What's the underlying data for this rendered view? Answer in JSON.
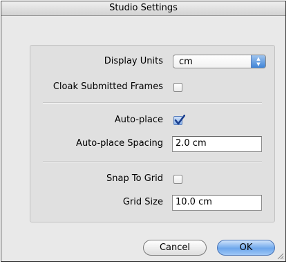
{
  "window": {
    "title": "Studio Settings"
  },
  "settings": {
    "display_units_label": "Display Units",
    "display_units_value": "cm",
    "cloak_label": "Cloak Submitted Frames",
    "cloak_checked": false,
    "autoplace_label": "Auto-place",
    "autoplace_checked": true,
    "autoplace_spacing_label": "Auto-place Spacing",
    "autoplace_spacing_value": "2.0 cm",
    "snap_label": "Snap To Grid",
    "snap_checked": false,
    "grid_size_label": "Grid Size",
    "grid_size_value": "10.0 cm"
  },
  "buttons": {
    "cancel": "Cancel",
    "ok": "OK"
  },
  "icons": {
    "popup": "up-down-arrows-icon",
    "check": "checkmark-icon",
    "resize": "resize-grip-icon"
  },
  "colors": {
    "accent": "#3f84d8",
    "panel": "#e0e0e0",
    "window": "#e9e9e9"
  }
}
